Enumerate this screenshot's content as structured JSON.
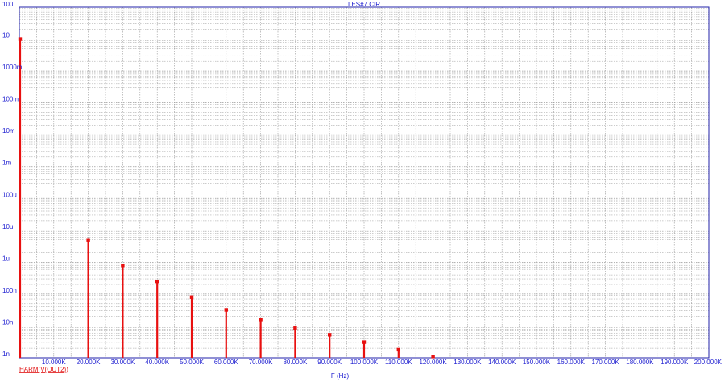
{
  "window": {
    "title": "LES#7.CIR"
  },
  "colors": {
    "background": "#ffffff",
    "frame": "#2222aa",
    "grid": "#9a9a9a",
    "series": "#e81010",
    "text": "#1a1ad0"
  },
  "chart_data": {
    "type": "bar",
    "title": "LES#7.CIR",
    "xlabel": "F (Hz)",
    "ylabel": "",
    "xlim": [
      0,
      200000
    ],
    "ylim": [
      1e-09,
      100
    ],
    "y_scale": "log",
    "grid": true,
    "x_ticks": [
      {
        "value": 10000,
        "label": "10.000K"
      },
      {
        "value": 20000,
        "label": "20.000K"
      },
      {
        "value": 30000,
        "label": "30.000K"
      },
      {
        "value": 40000,
        "label": "40.000K"
      },
      {
        "value": 50000,
        "label": "50.000K"
      },
      {
        "value": 60000,
        "label": "60.000K"
      },
      {
        "value": 70000,
        "label": "70.000K"
      },
      {
        "value": 80000,
        "label": "80.000K"
      },
      {
        "value": 90000,
        "label": "90.000K"
      },
      {
        "value": 100000,
        "label": "100.000K"
      },
      {
        "value": 110000,
        "label": "110.000K"
      },
      {
        "value": 120000,
        "label": "120.000K"
      },
      {
        "value": 130000,
        "label": "130.000K"
      },
      {
        "value": 140000,
        "label": "140.000K"
      },
      {
        "value": 150000,
        "label": "150.000K"
      },
      {
        "value": 160000,
        "label": "160.000K"
      },
      {
        "value": 170000,
        "label": "170.000K"
      },
      {
        "value": 180000,
        "label": "180.000K"
      },
      {
        "value": 190000,
        "label": "190.000K"
      },
      {
        "value": 200000,
        "label": "200.000K"
      }
    ],
    "y_ticks": [
      {
        "value": 100,
        "label": "100"
      },
      {
        "value": 10,
        "label": "10"
      },
      {
        "value": 1,
        "label": "1000m"
      },
      {
        "value": 0.1,
        "label": "100m"
      },
      {
        "value": 0.01,
        "label": "10m"
      },
      {
        "value": 0.001,
        "label": "1m"
      },
      {
        "value": 0.0001,
        "label": "100u"
      },
      {
        "value": 1e-05,
        "label": "10u"
      },
      {
        "value": 1e-06,
        "label": "1u"
      },
      {
        "value": 1e-07,
        "label": "100n"
      },
      {
        "value": 1e-08,
        "label": "10n"
      },
      {
        "value": 1e-09,
        "label": "1n"
      }
    ],
    "series": [
      {
        "name": "HARM(V(OUT2))",
        "x": [
          0,
          20000,
          30000,
          40000,
          50000,
          60000,
          70000,
          80000,
          90000,
          100000,
          110000,
          120000
        ],
        "values": [
          10,
          5e-06,
          8e-07,
          2.5e-07,
          8e-08,
          3.2e-08,
          1.6e-08,
          8.5e-09,
          5.3e-09,
          3.1e-09,
          1.8e-09,
          1.1e-09
        ]
      }
    ]
  }
}
